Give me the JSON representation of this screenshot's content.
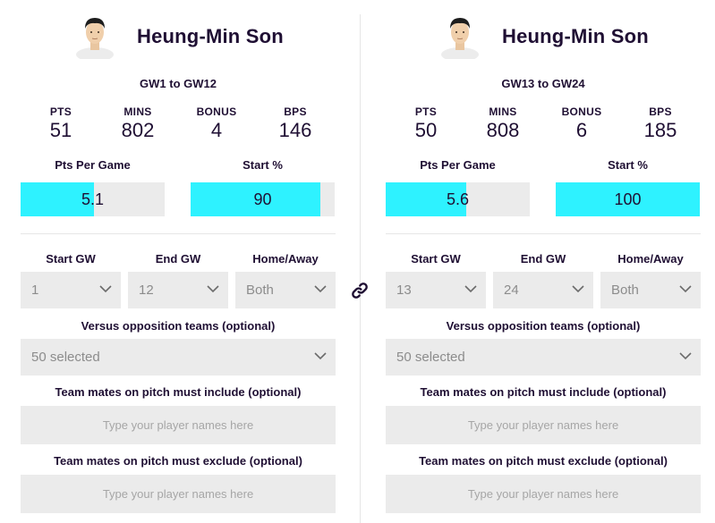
{
  "comparison": {
    "link_icon": "link-icon",
    "panels": [
      {
        "player_name": "Heung-Min Son",
        "gameweek_range": "GW1 to GW12",
        "stats": {
          "pts_label": "PTS",
          "pts": "51",
          "mins_label": "MINS",
          "mins": "802",
          "bonus_label": "BONUS",
          "bonus": "4",
          "bps_label": "BPS",
          "bps": "146"
        },
        "pts_per_game": {
          "label": "Pts Per Game",
          "value": "5.1",
          "fill_fraction": 0.51
        },
        "start_pct": {
          "label": "Start %",
          "value": "90",
          "fill_fraction": 0.9
        },
        "start_gw": {
          "label": "Start GW",
          "value": "1"
        },
        "end_gw": {
          "label": "End GW",
          "value": "12"
        },
        "home_away": {
          "label": "Home/Away",
          "value": "Both"
        },
        "opposition": {
          "label": "Versus opposition teams (optional)",
          "value": "50 selected"
        },
        "include": {
          "label": "Team mates on pitch must include (optional)",
          "placeholder": "Type your player names here"
        },
        "exclude": {
          "label": "Team mates on pitch must exclude (optional)",
          "placeholder": "Type your player names here"
        }
      },
      {
        "player_name": "Heung-Min Son",
        "gameweek_range": "GW13 to GW24",
        "stats": {
          "pts_label": "PTS",
          "pts": "50",
          "mins_label": "MINS",
          "mins": "808",
          "bonus_label": "BONUS",
          "bonus": "6",
          "bps_label": "BPS",
          "bps": "185"
        },
        "pts_per_game": {
          "label": "Pts Per Game",
          "value": "5.6",
          "fill_fraction": 0.56
        },
        "start_pct": {
          "label": "Start %",
          "value": "100",
          "fill_fraction": 1.0
        },
        "start_gw": {
          "label": "Start GW",
          "value": "13"
        },
        "end_gw": {
          "label": "End GW",
          "value": "24"
        },
        "home_away": {
          "label": "Home/Away",
          "value": "Both"
        },
        "opposition": {
          "label": "Versus opposition teams (optional)",
          "value": "50 selected"
        },
        "include": {
          "label": "Team mates on pitch must include (optional)",
          "placeholder": "Type your player names here"
        },
        "exclude": {
          "label": "Team mates on pitch must exclude (optional)",
          "placeholder": "Type your player names here"
        }
      }
    ],
    "colors": {
      "bar_fill": "#2ef2ff",
      "bar_track": "#ebebeb",
      "text": "#1f0f33"
    }
  }
}
